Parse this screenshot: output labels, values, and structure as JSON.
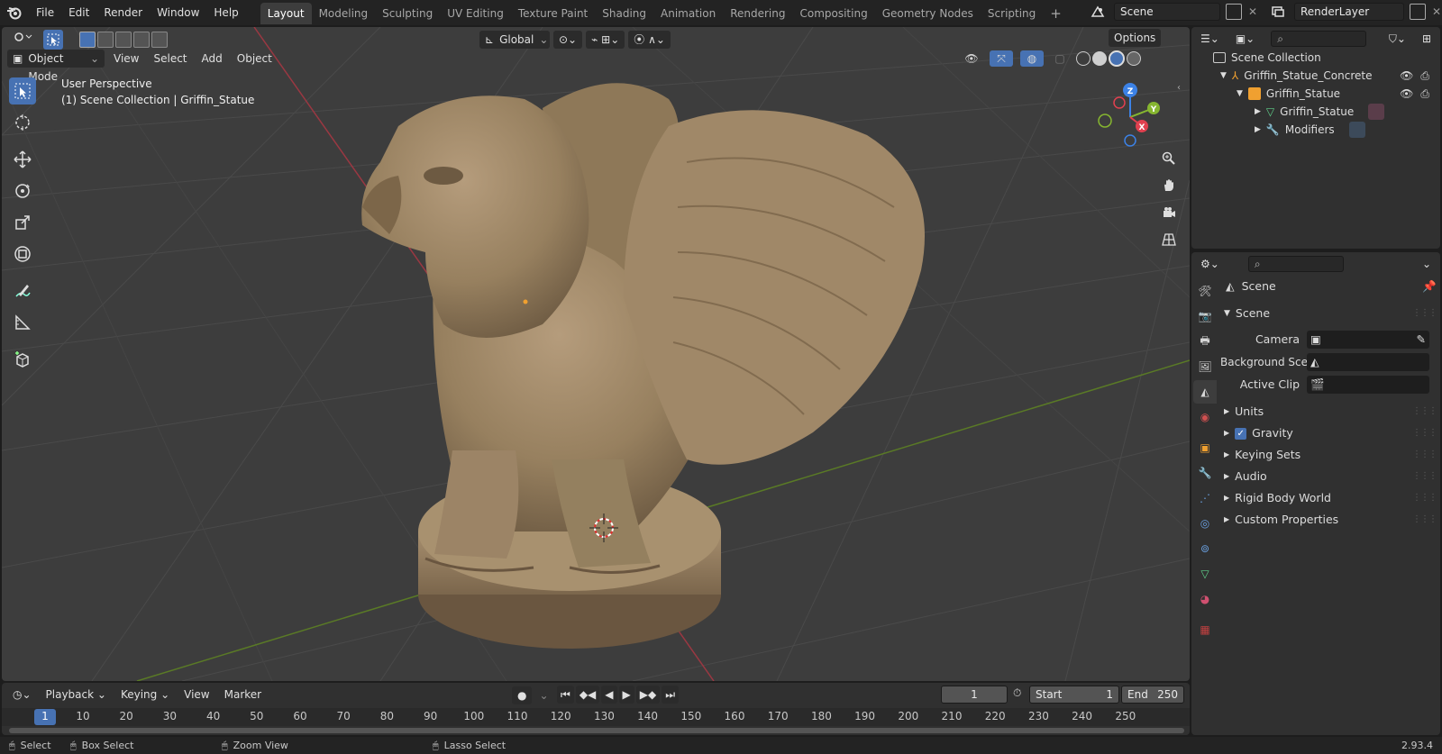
{
  "top_menu": [
    "File",
    "Edit",
    "Render",
    "Window",
    "Help"
  ],
  "workspace_tabs": [
    "Layout",
    "Modeling",
    "Sculpting",
    "UV Editing",
    "Texture Paint",
    "Shading",
    "Animation",
    "Rendering",
    "Compositing",
    "Geometry Nodes",
    "Scripting"
  ],
  "active_workspace": "Layout",
  "scene_name": "Scene",
  "view_layer": "RenderLayer",
  "viewport": {
    "mode": "Object Mode",
    "menus": [
      "View",
      "Select",
      "Add",
      "Object"
    ],
    "orientation": "Global",
    "options_label": "Options",
    "perspective_label": "User Perspective",
    "collection_label": "(1) Scene Collection | Griffin_Statue",
    "gizmo_axes": [
      "Z",
      "Y",
      "X"
    ]
  },
  "outliner": {
    "root": "Scene Collection",
    "items": [
      {
        "label": "Griffin_Statue_Concrete",
        "level": 1
      },
      {
        "label": "Griffin_Statue",
        "level": 2
      },
      {
        "label": "Griffin_Statue",
        "level": 3
      },
      {
        "label": "Modifiers",
        "level": 3
      }
    ]
  },
  "properties": {
    "context": "Scene",
    "panel_title": "Scene",
    "fields": [
      {
        "label": "Camera"
      },
      {
        "label": "Background Sce..."
      },
      {
        "label": "Active Clip"
      }
    ],
    "sections": [
      "Units",
      "Gravity",
      "Keying Sets",
      "Audio",
      "Rigid Body World",
      "Custom Properties"
    ],
    "gravity_checked": true
  },
  "timeline": {
    "menus": [
      "Playback",
      "Keying",
      "View",
      "Marker"
    ],
    "current_frame": "1",
    "start_label": "Start",
    "start": "1",
    "end_label": "End",
    "end": "250",
    "ruler": [
      "1",
      "10",
      "20",
      "30",
      "40",
      "50",
      "60",
      "70",
      "80",
      "90",
      "100",
      "110",
      "120",
      "130",
      "140",
      "150",
      "160",
      "170",
      "180",
      "190",
      "200",
      "210",
      "220",
      "230",
      "240",
      "250"
    ]
  },
  "statusbar": {
    "items": [
      "Select",
      "Box Select",
      "Zoom View",
      "Lasso Select"
    ],
    "version": "2.93.4"
  },
  "colors": {
    "accent": "#4772b3",
    "x_axis": "#e0404f",
    "y_axis": "#86b630",
    "z_axis": "#3c82e6",
    "statue": "#9c8466"
  }
}
